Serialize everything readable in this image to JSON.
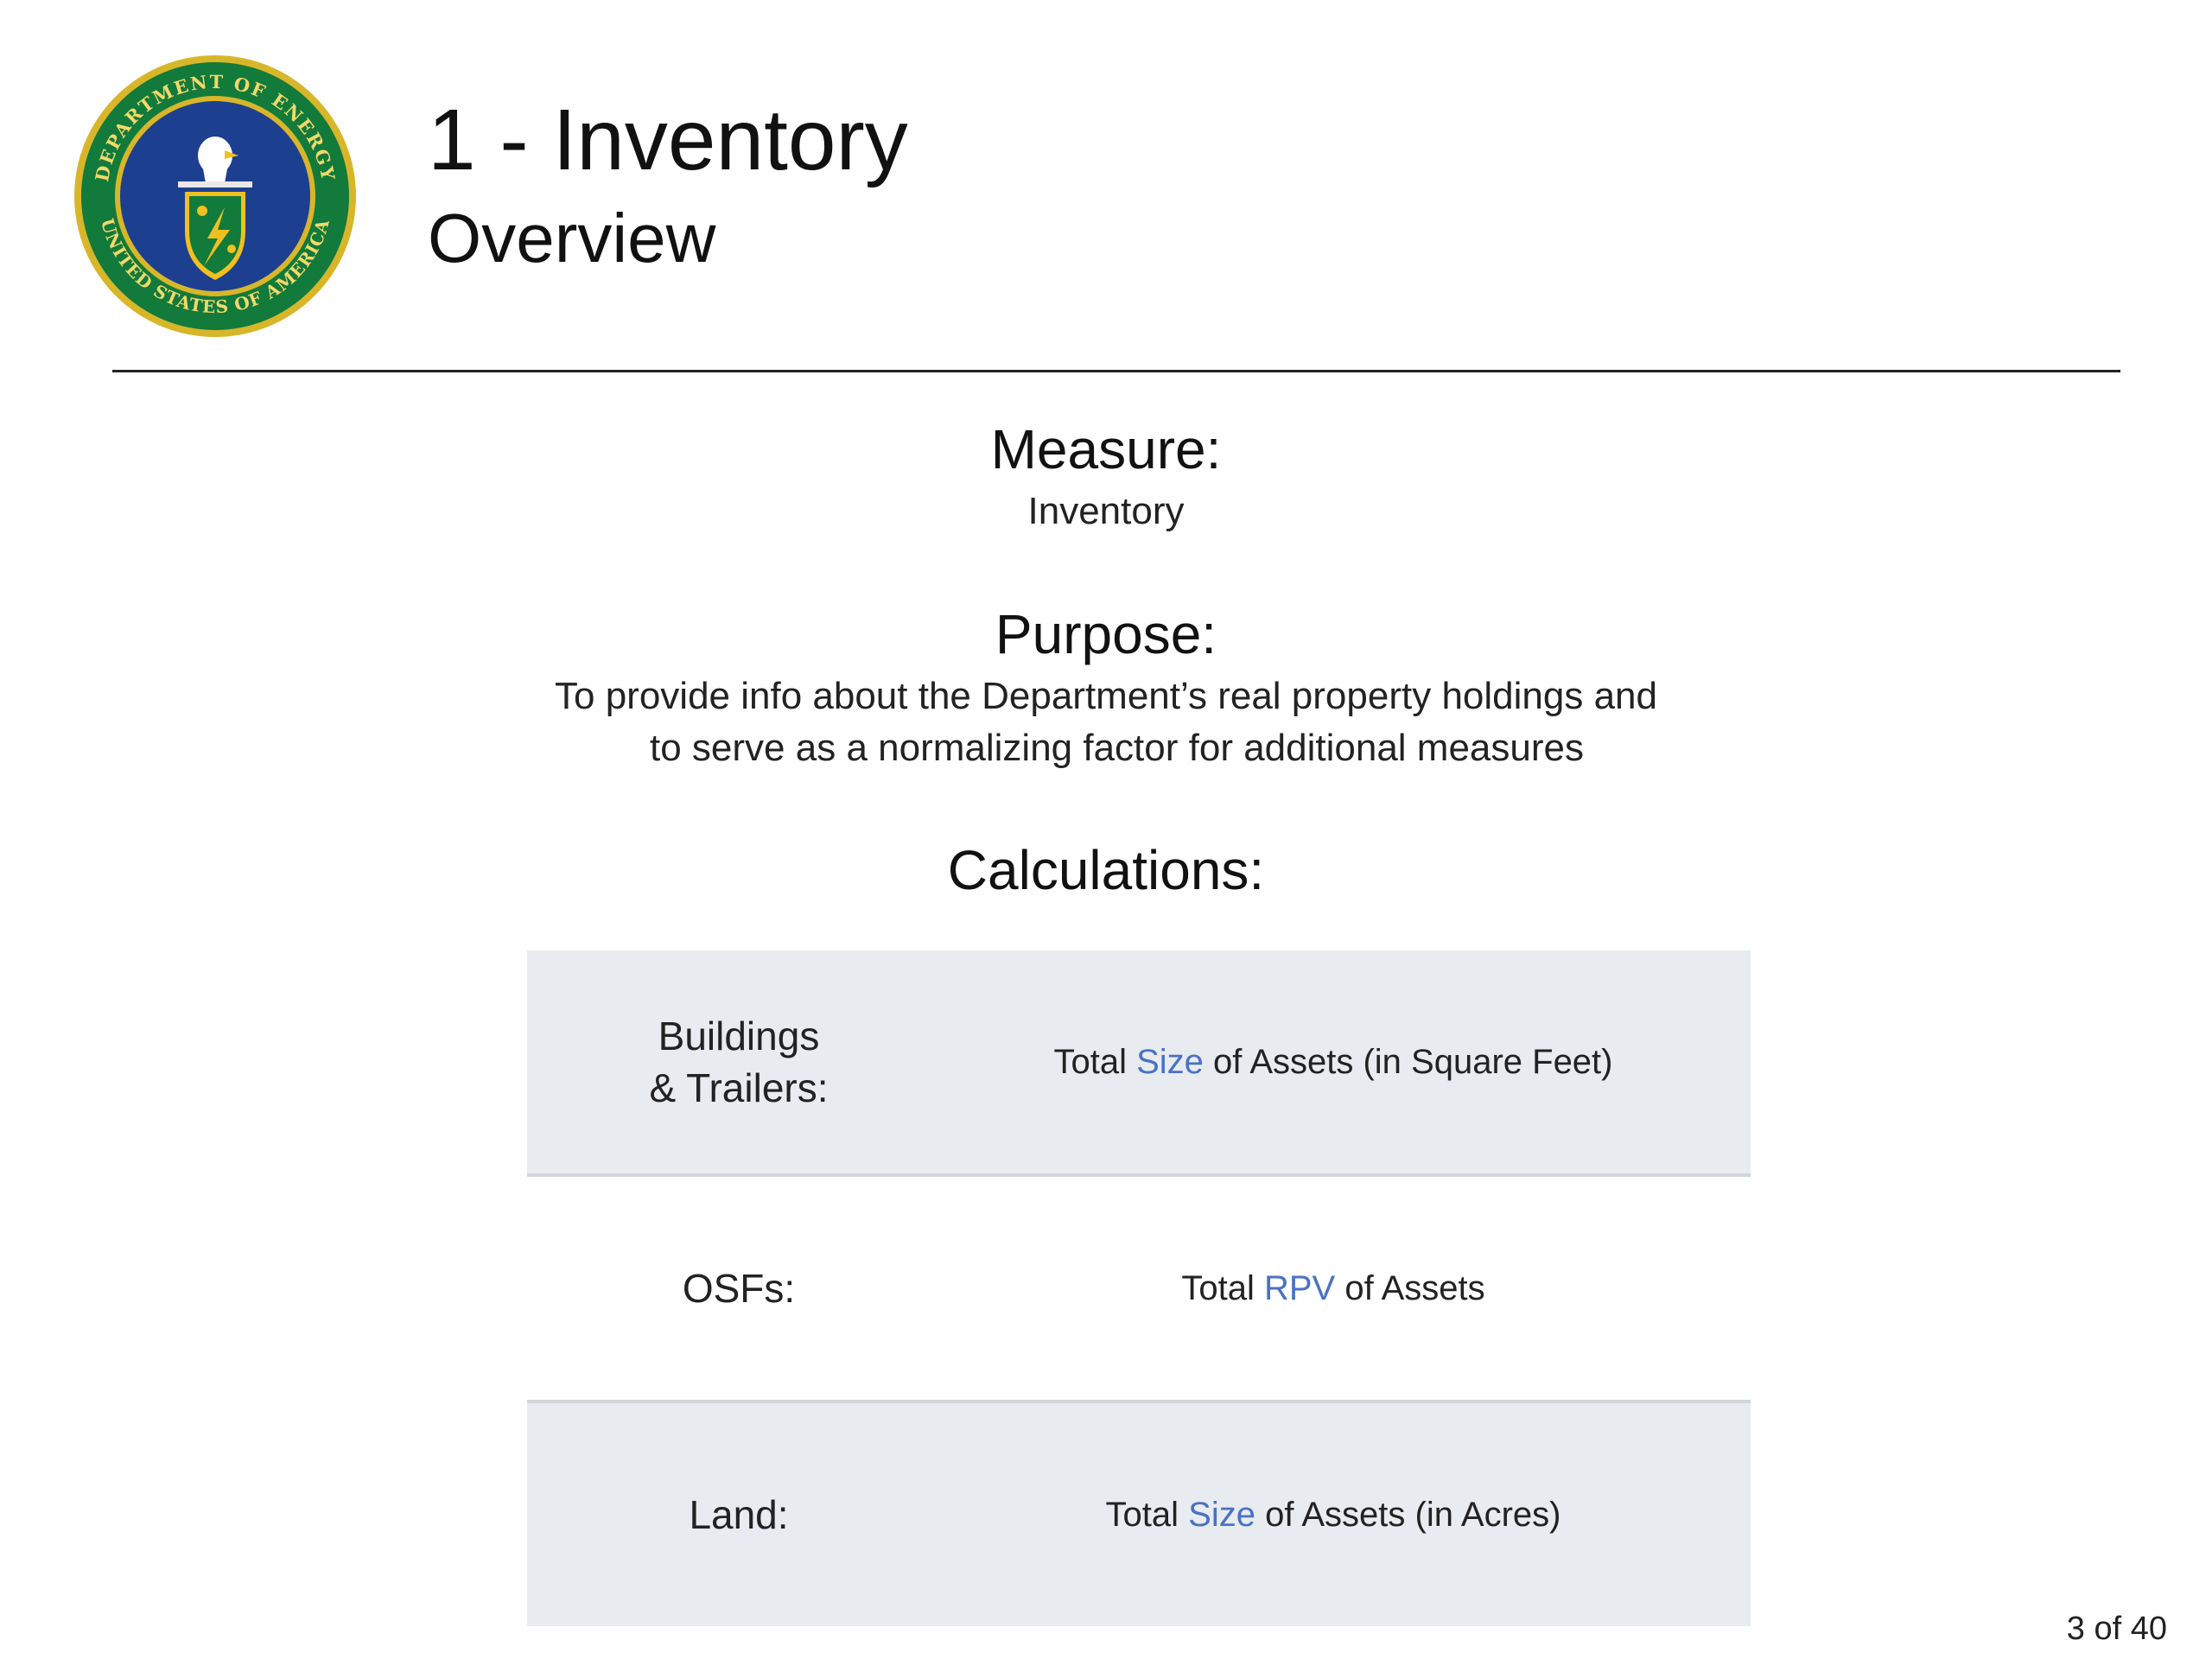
{
  "header": {
    "seal_text_top": "DEPARTMENT OF ENERGY",
    "seal_text_bottom": "UNITED STATES OF AMERICA",
    "title": "1 - Inventory",
    "subtitle": "Overview"
  },
  "measure": {
    "heading": "Measure:",
    "body": "Inventory"
  },
  "purpose": {
    "heading": "Purpose:",
    "line1": "To provide info about the Department’s real property holdings and",
    "line2": "to serve as a normalizing factor for additional measures"
  },
  "calculations": {
    "heading": "Calculations:",
    "rows": [
      {
        "label_line1": "Buildings",
        "label_line2": "& Trailers:",
        "formula_prefix": "Total",
        "formula_highlight": "Size",
        "formula_suffix": "of Assets (in Square Feet)"
      },
      {
        "label_line1": "OSFs:",
        "formula_prefix": "Total",
        "formula_highlight": "RPV",
        "formula_suffix": "of Assets"
      },
      {
        "label_line1": "Land:",
        "formula_prefix": "Total",
        "formula_highlight": "Size",
        "formula_suffix": "of Assets (in Acres)"
      }
    ]
  },
  "footer": {
    "page_number": "3 of 40"
  },
  "colors": {
    "highlight": "#4a72c4",
    "row_shade": "#e8ebef",
    "seal_blue": "#1d3f8f",
    "seal_green": "#127a3a",
    "seal_gold": "#d8b62a"
  }
}
